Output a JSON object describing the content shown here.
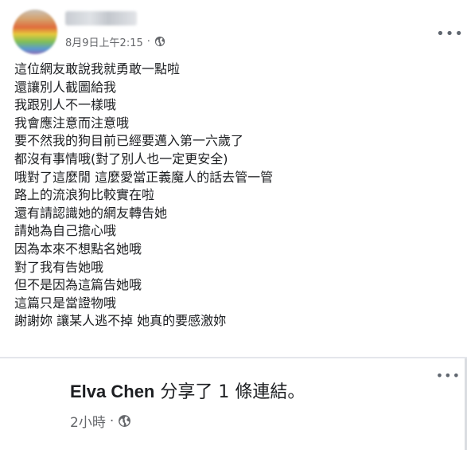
{
  "post": {
    "author_name": "▓▓▓▓ ▓▓",
    "timestamp": "8月9日上午2:15",
    "separator": "·",
    "privacy_icon": "globe-icon",
    "more_icon": "more-options-icon",
    "lines": [
      "這位網友敢說我就勇敢一點啦",
      "還讓別人截圖給我",
      "我跟別人不一樣哦",
      "我會應注意而注意哦",
      "要不然我的狗目前已經要邁入第一六歲了",
      "都沒有事情哦(對了別人也一定更安全)",
      "哦對了這麼閒 這麼愛當正義魔人的話去管一管",
      "路上的流浪狗比較實在啦",
      "還有請認識她的網友轉告她",
      "請她為自己擔心哦",
      "因為本來不想點名她哦",
      "對了我有告她哦",
      "但不是因為這篇告她哦",
      "這篇只是當證物哦",
      "謝謝妳 讓某人逃不掉 她真的要感激妳"
    ]
  },
  "share": {
    "name": "Elva Chen",
    "action": " 分享了 1 條連結。",
    "timestamp": "2小時",
    "separator": "·",
    "privacy_icon": "globe-icon"
  }
}
